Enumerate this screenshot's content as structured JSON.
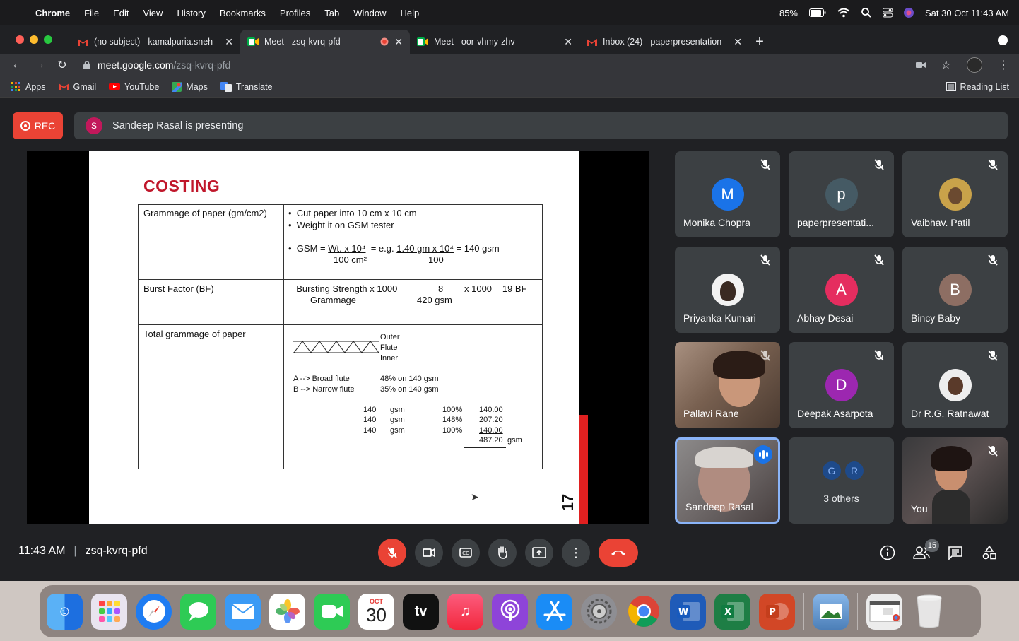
{
  "menubar": {
    "app": "Chrome",
    "items": [
      "File",
      "Edit",
      "View",
      "History",
      "Bookmarks",
      "Profiles",
      "Tab",
      "Window",
      "Help"
    ],
    "battery": "85%",
    "datetime": "Sat 30 Oct  11:43 AM"
  },
  "tabs": [
    {
      "label": "(no subject) - kamalpuria.sneh",
      "icon": "gmail-icon"
    },
    {
      "label": "Meet - zsq-kvrq-pfd",
      "icon": "meet-icon",
      "active": true
    },
    {
      "label": "Meet - oor-vhmy-zhv",
      "icon": "meet-icon"
    },
    {
      "label": "Inbox (24) - paperpresentation",
      "icon": "gmail-icon"
    }
  ],
  "toolbar": {
    "url_host": "meet.google.com",
    "url_path": "/zsq-kvrq-pfd"
  },
  "bookmarks": {
    "items": [
      "Apps",
      "Gmail",
      "YouTube",
      "Maps",
      "Translate"
    ],
    "reading_list": "Reading List"
  },
  "meet": {
    "rec_label": "REC",
    "presenter_initial": "S",
    "presenting_text": "Sandeep Rasal is presenting",
    "time": "11:43 AM",
    "meeting_code": "zsq-kvrq-pfd",
    "people_count": "15"
  },
  "slide": {
    "title": "COSTING",
    "row1_label": "Grammage of paper  (gm/cm2)",
    "row1_b1": "Cut paper into 10 cm x 10 cm",
    "row1_b2": "Weight it on GSM tester",
    "gsm_prefix": "GSM = ",
    "gsm_num": "Wt. x 10⁴",
    "gsm_eg": "= e.g. ",
    "gsm_eg_num": "1.40 gm x 10⁴",
    "gsm_result": " = 140 gsm",
    "gsm_den": "100 cm²",
    "gsm_eg_den": "100",
    "row2_label": "Burst Factor (BF)",
    "bf_prefix": "= ",
    "bf_num": "Bursting Strength ",
    "bf_mid": " x 1000 =",
    "bf_eg_num": "8",
    "bf_result": "x 1000 = 19 BF",
    "bf_den": "Grammage",
    "bf_eg_den": "420 gsm",
    "row3_label": "Total grammage of paper",
    "layer_outer": "Outer",
    "layer_flute": "Flute",
    "layer_inner": "Inner",
    "flute_a": "A --> Broad flute",
    "flute_b": "B --> Narrow flute",
    "flute_a_val": "48% on 140 gsm",
    "flute_b_val": "35% on 140 gsm",
    "calc": [
      {
        "g": "140",
        "u": "gsm",
        "p": "100%",
        "v": "140.00"
      },
      {
        "g": "140",
        "u": "gsm",
        "p": "148%",
        "v": "207.20"
      },
      {
        "g": "140",
        "u": "gsm",
        "p": "100%",
        "v": "140.00"
      }
    ],
    "total": "487.20",
    "total_unit": "gsm",
    "page": "17"
  },
  "participants": [
    {
      "name": "Monika Chopra",
      "initial": "M",
      "color": "#1a73e8"
    },
    {
      "name": "paperpresentati...",
      "initial": "p",
      "color": "#455a64"
    },
    {
      "name": "Vaibhav. Patil",
      "initial": "",
      "color": "#c9a24a"
    },
    {
      "name": "Priyanka Kumari",
      "initial": "",
      "color": "#f2f2f2"
    },
    {
      "name": "Abhay Desai",
      "initial": "A",
      "color": "#e52d5f"
    },
    {
      "name": "Bincy Baby",
      "initial": "B",
      "color": "#8d6e63"
    },
    {
      "name": "Pallavi Rane",
      "initial": "",
      "color": ""
    },
    {
      "name": "Deepak Asarpota",
      "initial": "D",
      "color": "#9c27b0"
    },
    {
      "name": "Dr R.G. Ratnawat",
      "initial": "",
      "color": "#eeeeee"
    },
    {
      "name": "Sandeep Rasal",
      "initial": "",
      "color": ""
    },
    {
      "name": "3 others",
      "initial": "",
      "color": ""
    },
    {
      "name": "You",
      "initial": "",
      "color": ""
    }
  ],
  "others_initials": [
    "G",
    "R"
  ],
  "dock": {
    "calendar_month": "OCT",
    "calendar_day": "30",
    "tv_label": "tv"
  }
}
